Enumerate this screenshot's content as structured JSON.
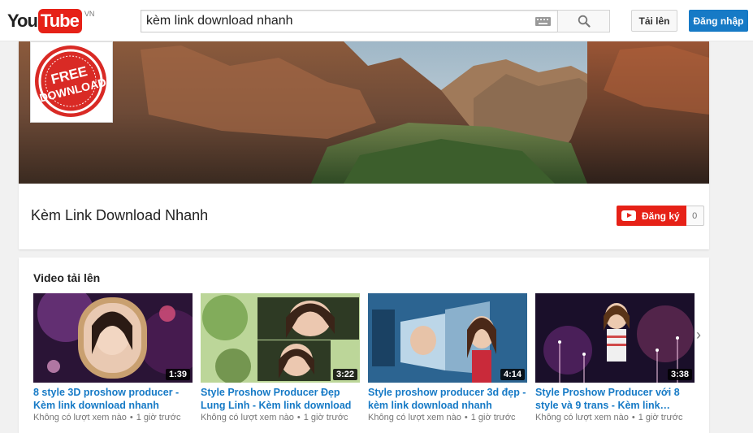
{
  "masthead": {
    "logo_you": "You",
    "logo_tube": "Tube",
    "logo_country": "VN",
    "search_value": "kèm link download nhanh",
    "upload_label": "Tải lên",
    "signin_label": "Đăng nhập"
  },
  "channel": {
    "avatar_text": "FREE DOWNLOAD",
    "title": "Kèm Link Download Nhanh",
    "subscribe_label": "Đăng ký",
    "subscriber_count": "0"
  },
  "uploads": {
    "title": "Video tải lên",
    "videos": [
      {
        "title": "8 style 3D proshow producer - Kèm link download nhanh",
        "duration": "1:39",
        "views": "Không có lượt xem nào",
        "age": "1 giờ trước"
      },
      {
        "title": "Style Proshow Producer Đẹp Lung Linh - Kèm link download Nhanh",
        "duration": "3:22",
        "views": "Không có lượt xem nào",
        "age": "1 giờ trước"
      },
      {
        "title": "Style proshow producer 3d đẹp - kèm link download nhanh",
        "duration": "4:14",
        "views": "Không có lượt xem nào",
        "age": "1 giờ trước"
      },
      {
        "title": "Style Proshow Producer với 8 style và 9 trans - Kèm link…",
        "duration": "3:38",
        "views": "Không có lượt xem nào",
        "age": "1 giờ trước"
      }
    ]
  },
  "colors": {
    "brand_red": "#e62117",
    "link_blue": "#167ac6",
    "signin_blue": "#167ac6"
  },
  "icons": {
    "search": "magnifier-icon",
    "keyboard": "keyboard-icon",
    "next": "chevron-right-icon"
  }
}
